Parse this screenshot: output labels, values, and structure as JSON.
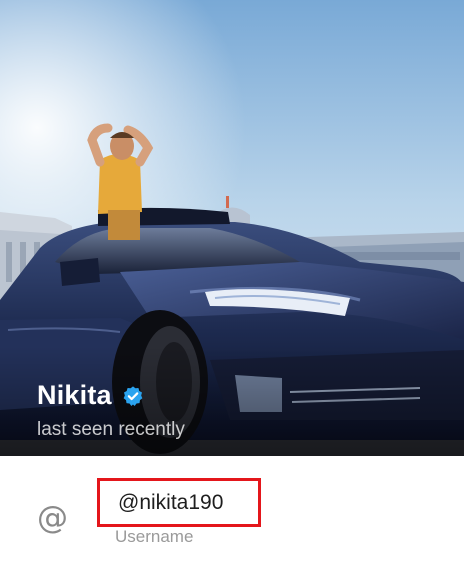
{
  "profile": {
    "name": "Nikita",
    "status": "last seen recently",
    "verified": true,
    "verified_color": "#2AA3EF"
  },
  "info": {
    "username_icon": "at-icon",
    "username_symbol": "@",
    "username": "@nikita190",
    "username_caption": "Username",
    "highlight_color": "#E4161B"
  }
}
